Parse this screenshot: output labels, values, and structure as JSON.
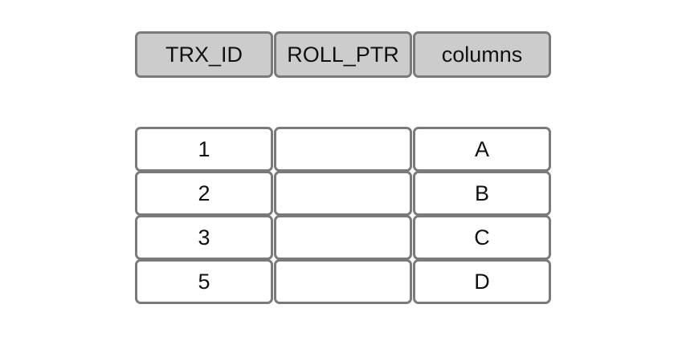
{
  "header": {
    "columns": [
      "TRX_ID",
      "ROLL_PTR",
      "columns"
    ]
  },
  "rows": [
    {
      "trx_id": "1",
      "roll_ptr": "",
      "value": "A"
    },
    {
      "trx_id": "2",
      "roll_ptr": "",
      "value": "B"
    },
    {
      "trx_id": "3",
      "roll_ptr": "",
      "value": "C"
    },
    {
      "trx_id": "5",
      "roll_ptr": "",
      "value": "D"
    }
  ],
  "colors": {
    "header_fill": "#cccccc",
    "border": "#7a7a7a",
    "cell_fill": "#ffffff"
  }
}
